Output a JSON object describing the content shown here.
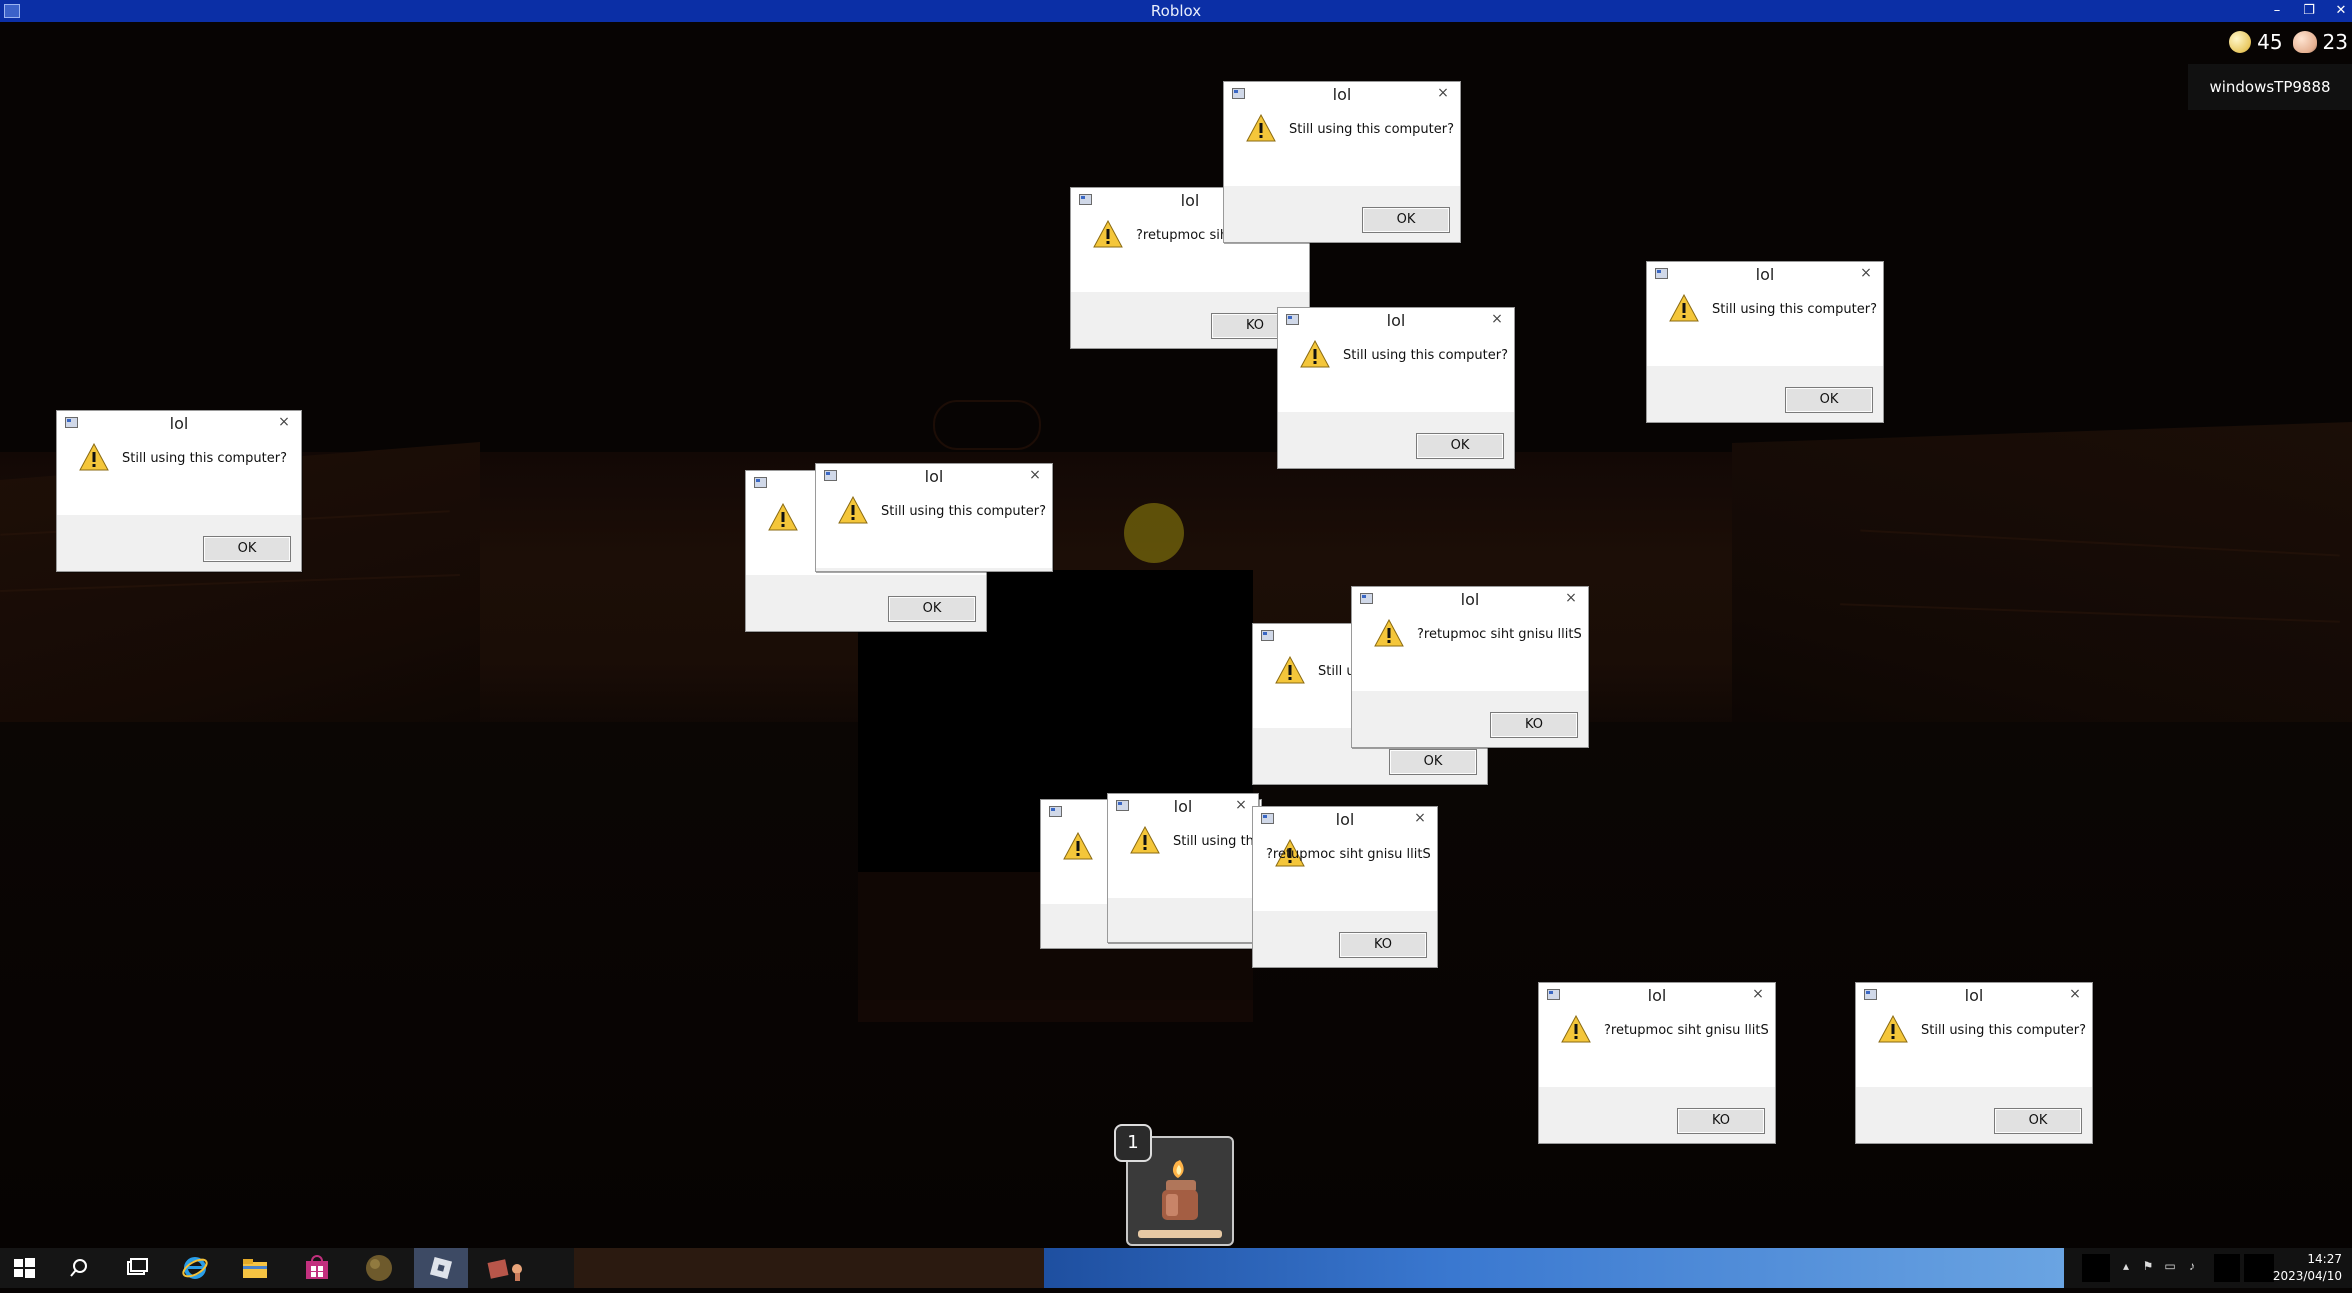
{
  "window": {
    "title": "Roblox"
  },
  "hud": {
    "coins": "45",
    "shells": "23",
    "player": "windowsTP9888"
  },
  "dialog": {
    "title": "lol",
    "close": "×",
    "message_normal": "Still using this computer?",
    "message_reversed": "?retupmoc siht gnisu llitS",
    "message_partial_1": "Still us",
    "message_partial_2": "Still using this co",
    "button_ok": "OK",
    "button_reversed": "KO"
  },
  "hotbar": {
    "slot_number": "1"
  },
  "taskbar": {
    "time": "14:27",
    "date": "2023/04/10"
  }
}
